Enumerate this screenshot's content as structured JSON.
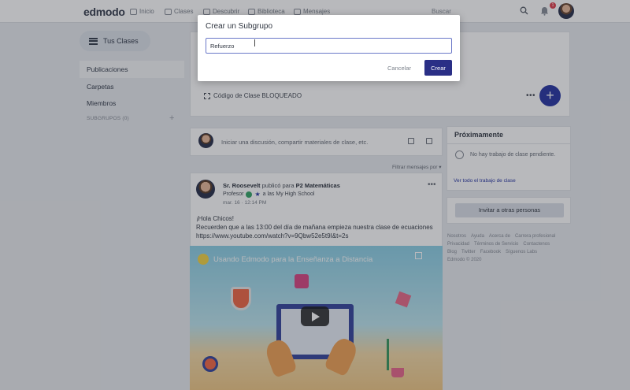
{
  "nav": {
    "logo": "edmodo",
    "items": [
      "Inicio",
      "Clases",
      "Descubrir",
      "Biblioteca",
      "Mensajes"
    ],
    "search_placeholder": "Buscar",
    "notification_count": "1"
  },
  "sidebar": {
    "classes_button": "Tus Clases",
    "items": [
      "Publicaciones",
      "Carpetas",
      "Miembros"
    ],
    "subgroups_label": "SUBGRUPOS (0)",
    "add_symbol": "+"
  },
  "class_header": {
    "code_label": "Código de Clase BLOQUEADO",
    "more_symbol": "•••",
    "add_symbol": "+"
  },
  "composer": {
    "placeholder": "Iniciar una discusión, compartir materiales de clase, etc.",
    "filter_label": "Filtrar mensajes por ▾"
  },
  "post": {
    "author": "Sr. Roosevelt",
    "published_to": "publicó para",
    "group": "P2 Matemáticas",
    "role": "Profesor",
    "school": "a las My High School",
    "timestamp": "mar. 16 · 12:14 PM",
    "more_symbol": "•••",
    "body_line1": "¡Hola Chicos!",
    "body_line2": "Recuerden que a las 13:00 del día de mañana empieza nuestra clase de ecuaciones",
    "body_link": "https://www.youtube.com/watch?v=9Qbw52e5t9I&t=2s",
    "video_title": "Usando Edmodo para la Enseñanza a Distancia"
  },
  "upcoming": {
    "title": "Próximamente",
    "empty_text": "No hay trabajo de clase pendiente.",
    "link": "Ver todo el trabajo de clase"
  },
  "invite": {
    "button": "Invitar a otras personas"
  },
  "footer": {
    "links": [
      "Nosotros",
      "Ayuda",
      "Acerca de",
      "Carrera profesional",
      "Privacidad",
      "Términos de Servicio",
      "Contactenos",
      "Blog",
      "Twitter",
      "Facebook",
      "Síguenos Labs"
    ],
    "copyright": "Edmodo © 2020"
  },
  "modal": {
    "title": "Crear un Subgrupo",
    "input_value": "Refuerzo",
    "cancel": "Cancelar",
    "create": "Crear"
  }
}
